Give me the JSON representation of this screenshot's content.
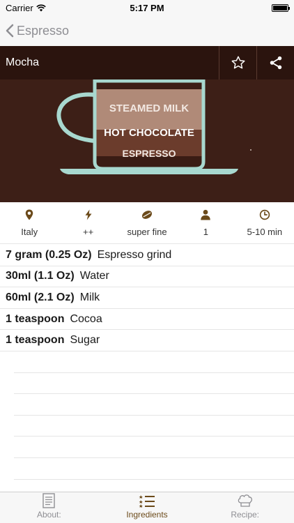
{
  "status": {
    "carrier": "Carrier",
    "time": "5:17 PM"
  },
  "nav": {
    "back_label": "Espresso"
  },
  "hero": {
    "title": "Mocha",
    "layers": [
      "STEAMED MILK",
      "HOT CHOCOLATE",
      "ESPRESSO"
    ]
  },
  "info": [
    {
      "icon": "location-pin-icon",
      "value": "Italy"
    },
    {
      "icon": "lightning-icon",
      "value": "++"
    },
    {
      "icon": "coffee-bean-icon",
      "value": "super fine"
    },
    {
      "icon": "person-icon",
      "value": "1"
    },
    {
      "icon": "clock-icon",
      "value": "5-10 min"
    }
  ],
  "ingredients": [
    {
      "qty": "7 gram (0.25 Oz)",
      "name": "Espresso grind"
    },
    {
      "qty": "30ml (1.1 Oz)",
      "name": "Water"
    },
    {
      "qty": "60ml (2.1 Oz)",
      "name": "Milk"
    },
    {
      "qty": "1 teaspoon",
      "name": "Cocoa"
    },
    {
      "qty": "1 teaspoon",
      "name": "Sugar"
    }
  ],
  "tabs": [
    {
      "label": "About:",
      "icon": "document-icon",
      "active": false
    },
    {
      "label": "Ingredients",
      "icon": "list-icon",
      "active": true
    },
    {
      "label": "Recipe:",
      "icon": "chef-hat-icon",
      "active": false
    }
  ],
  "colors": {
    "accent": "#6b4a1a",
    "hero_bg": "#3d1f17",
    "steamed_milk": "#b08a78",
    "hot_chocolate": "#6b3c2c",
    "espresso": "#3a1c14",
    "cup_outline": "#a8d8cf"
  }
}
